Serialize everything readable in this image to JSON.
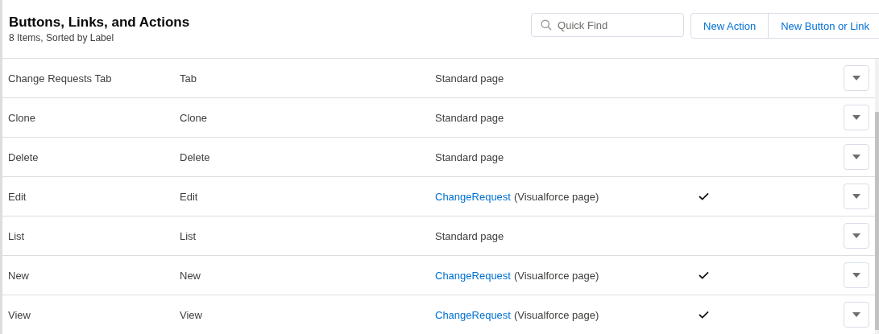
{
  "header": {
    "title": "Buttons, Links, and Actions",
    "subtitle": "8 Items, Sorted by Label"
  },
  "search": {
    "placeholder": "Quick Find"
  },
  "buttons": [
    "New Action",
    "New Button or Link"
  ],
  "rows": [
    {
      "label": "Change Requests Tab",
      "name": "Tab",
      "content": {
        "text": "Standard page"
      },
      "checked": false
    },
    {
      "label": "Clone",
      "name": "Clone",
      "content": {
        "text": "Standard page"
      },
      "checked": false
    },
    {
      "label": "Delete",
      "name": "Delete",
      "content": {
        "text": "Standard page"
      },
      "checked": false
    },
    {
      "label": "Edit",
      "name": "Edit",
      "content": {
        "link": "ChangeRequest",
        "text": "(Visualforce page)"
      },
      "checked": true
    },
    {
      "label": "List",
      "name": "List",
      "content": {
        "text": "Standard page"
      },
      "checked": false
    },
    {
      "label": "New",
      "name": "New",
      "content": {
        "link": "ChangeRequest",
        "text": "(Visualforce page)"
      },
      "checked": true
    },
    {
      "label": "View",
      "name": "View",
      "content": {
        "link": "ChangeRequest",
        "text": "(Visualforce page)"
      },
      "checked": true
    }
  ]
}
